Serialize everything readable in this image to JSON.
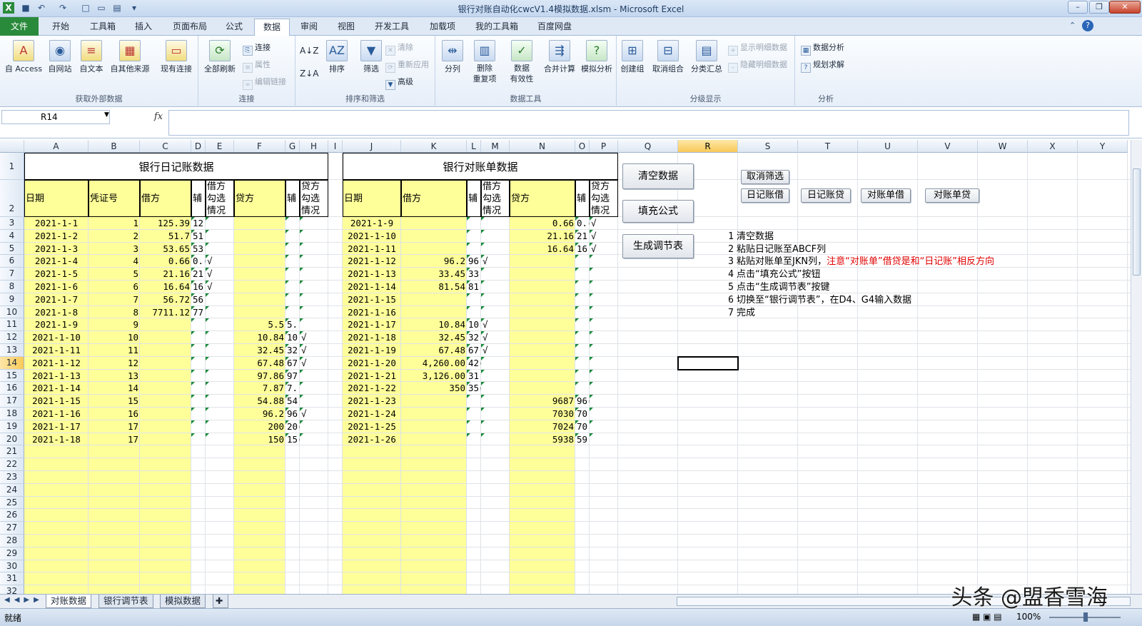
{
  "window": {
    "title": "银行对账自动化cwcV1.4模拟数据.xlsm - Microsoft Excel"
  },
  "ribbon_tabs": [
    "文件",
    "开始",
    "工具箱",
    "插入",
    "页面布局",
    "公式",
    "数据",
    "审阅",
    "视图",
    "开发工具",
    "加载项",
    "我的工具箱",
    "百度网盘"
  ],
  "ribbon": {
    "g1": {
      "label": "获取外部数据",
      "buttons": [
        "自 Access",
        "自网站",
        "自文本",
        "自其他来源",
        "现有连接"
      ]
    },
    "g2": {
      "label": "连接",
      "big": "全部刷新",
      "small": [
        "连接",
        "属性",
        "编辑链接"
      ]
    },
    "g3": {
      "label": "排序和筛选",
      "sort": "排序",
      "filter": "筛选",
      "small": [
        "清除",
        "重新应用",
        "高级"
      ]
    },
    "g4": {
      "label": "数据工具",
      "buttons": [
        "分列",
        "删除\n重复项",
        "数据\n有效性",
        "合并计算",
        "模拟分析"
      ]
    },
    "g5": {
      "label": "分级显示",
      "buttons": [
        "创建组",
        "取消组合",
        "分类汇总"
      ],
      "small": [
        "显示明细数据",
        "隐藏明细数据"
      ]
    },
    "g6": {
      "label": "分析",
      "small": [
        "数据分析",
        "规划求解"
      ]
    }
  },
  "formula_bar": {
    "name_box": "R14",
    "fx": "fx",
    "value": ""
  },
  "columns": [
    "A",
    "B",
    "C",
    "D",
    "E",
    "F",
    "G",
    "H",
    "I",
    "J",
    "K",
    "L",
    "M",
    "N",
    "O",
    "P",
    "Q",
    "R",
    "S",
    "T",
    "U",
    "V",
    "W",
    "X",
    "Y"
  ],
  "selected_cell": "R14",
  "titles": {
    "journal": "银行日记账数据",
    "statement": "银行对账单数据"
  },
  "headers": {
    "journal": [
      "日期",
      "凭证号",
      "借方",
      "辅",
      "借方勾选情况",
      "贷方",
      "辅",
      "贷方勾选情况"
    ],
    "statement": [
      "日期",
      "借方",
      "辅",
      "借方勾选情况",
      "贷方",
      "辅",
      "贷方勾选情况"
    ]
  },
  "journal_rows": [
    {
      "date": "2021-1-1",
      "no": "1",
      "debit": "125.39",
      "aux1": "12!",
      "chk1": "",
      "credit": "",
      "aux2": "",
      "chk2": ""
    },
    {
      "date": "2021-1-2",
      "no": "2",
      "debit": "51.7",
      "aux1": "51.",
      "chk1": "",
      "credit": "",
      "aux2": "",
      "chk2": ""
    },
    {
      "date": "2021-1-3",
      "no": "3",
      "debit": "53.65",
      "aux1": "53.",
      "chk1": "",
      "credit": "",
      "aux2": "",
      "chk2": ""
    },
    {
      "date": "2021-1-4",
      "no": "4",
      "debit": "0.66",
      "aux1": "0.(",
      "chk1": "√",
      "credit": "",
      "aux2": "",
      "chk2": ""
    },
    {
      "date": "2021-1-5",
      "no": "5",
      "debit": "21.16",
      "aux1": "21.",
      "chk1": "√",
      "credit": "",
      "aux2": "",
      "chk2": ""
    },
    {
      "date": "2021-1-6",
      "no": "6",
      "debit": "16.64",
      "aux1": "16.",
      "chk1": "√",
      "credit": "",
      "aux2": "",
      "chk2": ""
    },
    {
      "date": "2021-1-7",
      "no": "7",
      "debit": "56.72",
      "aux1": "56.",
      "chk1": "",
      "credit": "",
      "aux2": "",
      "chk2": ""
    },
    {
      "date": "2021-1-8",
      "no": "8",
      "debit": "7711.12",
      "aux1": "77:",
      "chk1": "",
      "credit": "",
      "aux2": "",
      "chk2": ""
    },
    {
      "date": "2021-1-9",
      "no": "9",
      "debit": "",
      "aux1": "",
      "chk1": "",
      "credit": "5.5",
      "aux2": "5.!",
      "chk2": ""
    },
    {
      "date": "2021-1-10",
      "no": "10",
      "debit": "",
      "aux1": "",
      "chk1": "",
      "credit": "10.84",
      "aux2": "10.",
      "chk2": "√"
    },
    {
      "date": "2021-1-11",
      "no": "11",
      "debit": "",
      "aux1": "",
      "chk1": "",
      "credit": "32.45",
      "aux2": "32.",
      "chk2": "√"
    },
    {
      "date": "2021-1-12",
      "no": "12",
      "debit": "",
      "aux1": "",
      "chk1": "",
      "credit": "67.48",
      "aux2": "67.",
      "chk2": "√"
    },
    {
      "date": "2021-1-13",
      "no": "13",
      "debit": "",
      "aux1": "",
      "chk1": "",
      "credit": "97.86",
      "aux2": "97.",
      "chk2": ""
    },
    {
      "date": "2021-1-14",
      "no": "14",
      "debit": "",
      "aux1": "",
      "chk1": "",
      "credit": "7.87",
      "aux2": "7.!",
      "chk2": ""
    },
    {
      "date": "2021-1-15",
      "no": "15",
      "debit": "",
      "aux1": "",
      "chk1": "",
      "credit": "54.88",
      "aux2": "54.",
      "chk2": ""
    },
    {
      "date": "2021-1-16",
      "no": "16",
      "debit": "",
      "aux1": "",
      "chk1": "",
      "credit": "96.2",
      "aux2": "96.",
      "chk2": "√"
    },
    {
      "date": "2021-1-17",
      "no": "17",
      "debit": "",
      "aux1": "",
      "chk1": "",
      "credit": "200",
      "aux2": "20(",
      "chk2": ""
    },
    {
      "date": "2021-1-18",
      "no": "17",
      "debit": "",
      "aux1": "",
      "chk1": "",
      "credit": "150",
      "aux2": "15(",
      "chk2": ""
    }
  ],
  "statement_rows": [
    {
      "date": "2021-1-9",
      "debit": "",
      "aux1": "",
      "chk1": "",
      "credit": "0.66",
      "aux2": "0.(",
      "chk2": "√"
    },
    {
      "date": "2021-1-10",
      "debit": "",
      "aux1": "",
      "chk1": "",
      "credit": "21.16",
      "aux2": "21.",
      "chk2": "√"
    },
    {
      "date": "2021-1-11",
      "debit": "",
      "aux1": "",
      "chk1": "",
      "credit": "16.64",
      "aux2": "16.",
      "chk2": "√"
    },
    {
      "date": "2021-1-12",
      "debit": "96.2",
      "aux1": "96.",
      "chk1": "√",
      "credit": "",
      "aux2": "",
      "chk2": ""
    },
    {
      "date": "2021-1-13",
      "debit": "33.45",
      "aux1": "33.",
      "chk1": "",
      "credit": "",
      "aux2": "",
      "chk2": ""
    },
    {
      "date": "2021-1-14",
      "debit": "81.54",
      "aux1": "81.",
      "chk1": "",
      "credit": "",
      "aux2": "",
      "chk2": ""
    },
    {
      "date": "2021-1-15",
      "debit": "",
      "aux1": "",
      "chk1": "",
      "credit": "",
      "aux2": "",
      "chk2": ""
    },
    {
      "date": "2021-1-16",
      "debit": "",
      "aux1": "",
      "chk1": "",
      "credit": "",
      "aux2": "",
      "chk2": ""
    },
    {
      "date": "2021-1-17",
      "debit": "10.84",
      "aux1": "10.",
      "chk1": "√",
      "credit": "",
      "aux2": "",
      "chk2": ""
    },
    {
      "date": "2021-1-18",
      "debit": "32.45",
      "aux1": "32.",
      "chk1": "√",
      "credit": "",
      "aux2": "",
      "chk2": ""
    },
    {
      "date": "2021-1-19",
      "debit": "67.48",
      "aux1": "67.",
      "chk1": "√",
      "credit": "",
      "aux2": "",
      "chk2": ""
    },
    {
      "date": "2021-1-20",
      "debit": "4,260.00",
      "aux1": "42(",
      "chk1": "",
      "credit": "",
      "aux2": "",
      "chk2": ""
    },
    {
      "date": "2021-1-21",
      "debit": "3,126.00",
      "aux1": "31:",
      "chk1": "",
      "credit": "",
      "aux2": "",
      "chk2": ""
    },
    {
      "date": "2021-1-22",
      "debit": "350",
      "aux1": "35(",
      "chk1": "",
      "credit": "",
      "aux2": "",
      "chk2": ""
    },
    {
      "date": "2021-1-23",
      "debit": "",
      "aux1": "",
      "chk1": "",
      "credit": "9687",
      "aux2": "96(",
      "chk2": ""
    },
    {
      "date": "2021-1-24",
      "debit": "",
      "aux1": "",
      "chk1": "",
      "credit": "7030",
      "aux2": "70:",
      "chk2": ""
    },
    {
      "date": "2021-1-25",
      "debit": "",
      "aux1": "",
      "chk1": "",
      "credit": "7024",
      "aux2": "70:",
      "chk2": ""
    },
    {
      "date": "2021-1-26",
      "debit": "",
      "aux1": "",
      "chk1": "",
      "credit": "5938",
      "aux2": "59:",
      "chk2": ""
    }
  ],
  "macro_buttons": {
    "clear": "清空数据",
    "fill": "填充公式",
    "gen": "生成调节表",
    "cancel_filter": "取消筛选",
    "jdeb": "日记账借",
    "jcred": "日记账贷",
    "sdeb": "对账单借",
    "scred": "对账单贷"
  },
  "instructions": [
    {
      "n": "1",
      "text": "清空数据",
      "red": ""
    },
    {
      "n": "2",
      "text": "粘贴日记账至ABCF列",
      "red": ""
    },
    {
      "n": "3",
      "text": "粘贴对账单至JKN列，",
      "red": "注意“对账单”借贷是和“日记账”相反方向"
    },
    {
      "n": "4",
      "text": "点击“填充公式”按钮",
      "red": ""
    },
    {
      "n": "5",
      "text": "点击“生成调节表”按键",
      "red": ""
    },
    {
      "n": "6",
      "text": "切换至“银行调节表”，在D4、G4输入数据",
      "red": ""
    },
    {
      "n": "7",
      "text": "完成",
      "red": ""
    }
  ],
  "sheet_tabs": [
    "对账数据",
    "银行调节表",
    "模拟数据"
  ],
  "status": {
    "ready": "就绪",
    "zoom": "100%"
  },
  "watermark": "头条 @盟香雪海"
}
